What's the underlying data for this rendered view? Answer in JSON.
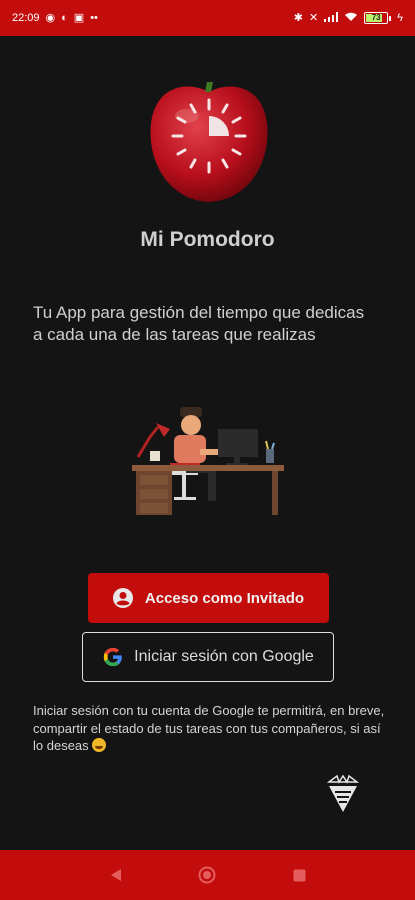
{
  "status_bar": {
    "time": "22:09",
    "battery": "73",
    "left_icons": [
      "whatsapp-icon",
      "messenger-icon",
      "app-icon",
      "more-dots-icon"
    ],
    "right_icons": [
      "bluetooth-icon",
      "mute-icon",
      "signal-icon",
      "wifi-icon",
      "battery-icon",
      "charging-icon"
    ]
  },
  "app": {
    "title": "Mi Pomodoro",
    "tagline": "Tu App para gestión del tiempo que dedicas a cada una de las tareas que realizas"
  },
  "buttons": {
    "guest_label": "Acceso como Invitado",
    "google_label": "Iniciar sesión con Google"
  },
  "disclaimer": "Iniciar sesión con tu cuenta de Google te permitirá, en breve, compartir el estado de tus tareas con tus compañeros, si así lo deseas",
  "colors": {
    "accent": "#c30d0d",
    "background": "#141414",
    "text": "#d6d6d6"
  },
  "nav": [
    "back-icon",
    "home-icon",
    "recents-icon"
  ]
}
